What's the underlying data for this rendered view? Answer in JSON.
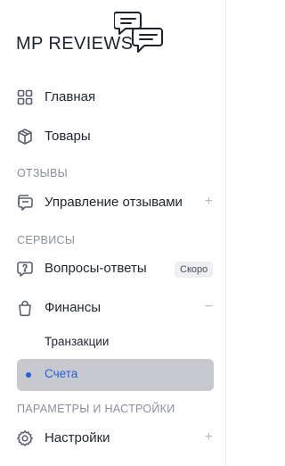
{
  "brand": {
    "name": "MP REVIEWS"
  },
  "nav": {
    "home": {
      "label": "Главная",
      "icon": "grid-icon"
    },
    "products": {
      "label": "Товары",
      "icon": "box-icon"
    },
    "reviews_section": "ОТЗЫВЫ",
    "reviews_manage": {
      "label": "Управление отзывами",
      "icon": "chat-bubbles-icon",
      "expand": "+"
    },
    "services_section": "СЕРВИСЫ",
    "qa": {
      "label": "Вопросы-ответы",
      "icon": "question-bubble-icon",
      "badge": "Скоро"
    },
    "finance": {
      "label": "Финансы",
      "icon": "shopping-bag-icon",
      "collapse": "−"
    },
    "finance_children": {
      "transactions": "Транзакции",
      "accounts": "Счета"
    },
    "settings_section": "ПАРАМЕТРЫ И НАСТРОЙКИ",
    "settings": {
      "label": "Настройки",
      "icon": "gear-icon",
      "expand": "+"
    }
  },
  "colors": {
    "accent": "#1f5fe0",
    "active_bg": "#c8c9ce",
    "muted": "#8a8f9c"
  }
}
